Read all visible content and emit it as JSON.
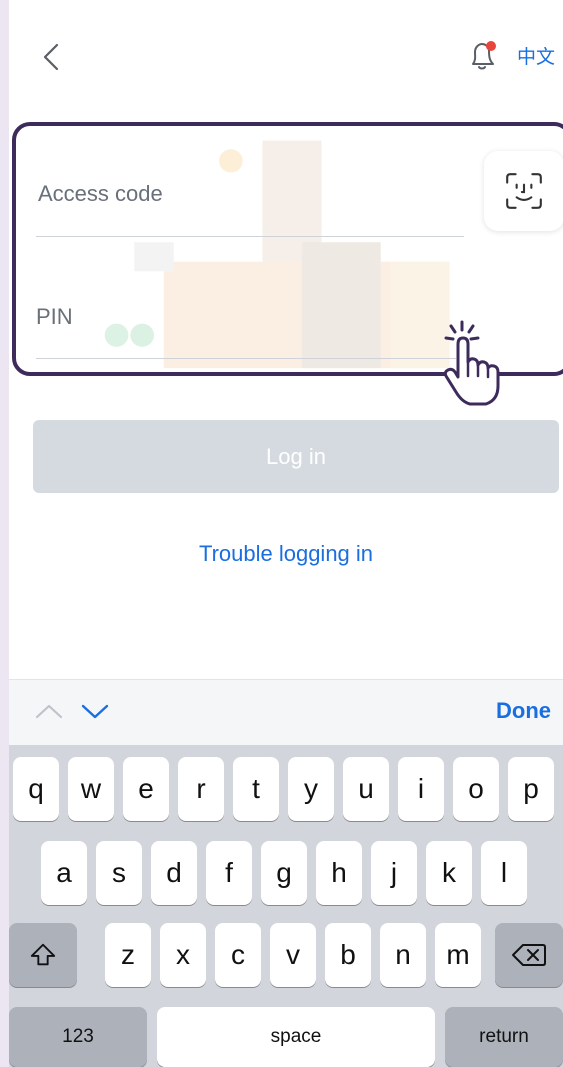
{
  "header": {
    "back_icon": "chevron-left-icon",
    "notification_icon": "bell-icon",
    "language_label": "中文"
  },
  "form": {
    "access_code_label": "Access code",
    "pin_label": "PIN",
    "face_id_icon": "face-id-icon"
  },
  "login": {
    "button_label": "Log in"
  },
  "trouble_link": "Trouble logging in",
  "accessory": {
    "done_label": "Done"
  },
  "keyboard": {
    "row1": [
      "q",
      "w",
      "e",
      "r",
      "t",
      "y",
      "u",
      "i",
      "o",
      "p"
    ],
    "row2": [
      "a",
      "s",
      "d",
      "f",
      "g",
      "h",
      "j",
      "k",
      "l"
    ],
    "row3": [
      "z",
      "x",
      "c",
      "v",
      "b",
      "n",
      "m"
    ],
    "numbers_label": "123",
    "space_label": "space",
    "return_label": "return"
  },
  "colors": {
    "accent": "#1a6fe0",
    "card_border": "#3d2b5c",
    "login_disabled": "#d5dae1",
    "notification_dot": "#e8453c"
  }
}
